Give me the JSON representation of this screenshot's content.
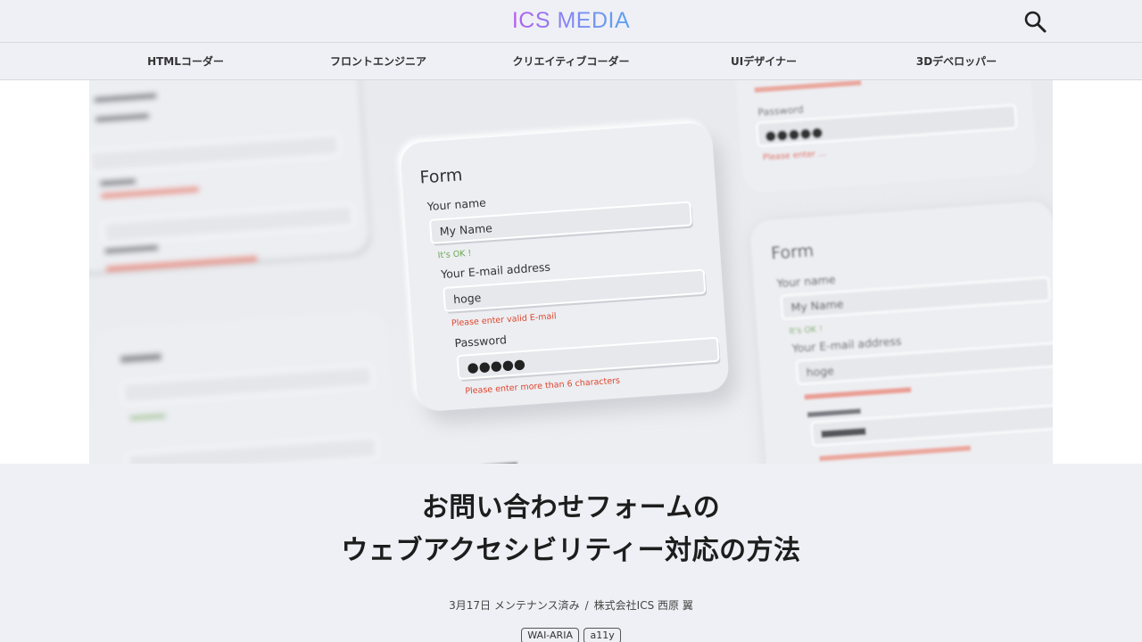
{
  "header": {
    "logo": "ICS MEDIA",
    "search_icon": "search-icon"
  },
  "categories": [
    "HTMLコーダー",
    "フロントエンジニア",
    "クリエイティブコーダー",
    "UIデザイナー",
    "3Dデベロッパー"
  ],
  "hero": {
    "main_card": {
      "title": "Form",
      "name_label": "Your name",
      "name_value": "My Name",
      "name_ok": "It's OK !",
      "email_label": "Your E-mail address",
      "email_value": "hoge",
      "email_error": "Please enter valid E-mail",
      "password_label": "Password",
      "password_value": "●●●●●",
      "password_error": "Please enter more than 6 characters"
    },
    "right_card": {
      "title": "Form",
      "name_label": "Your name",
      "name_value": "My Name",
      "name_ok": "It's OK !",
      "email_label": "Your E-mail address",
      "email_value": "hoge"
    },
    "top_right_card": {
      "password_label": "Password",
      "password_error": "Please enter ...",
      "ok_color": "#6aa84f",
      "error_color": "#e0452c"
    }
  },
  "article": {
    "title_line1": "お問い合わせフォームの",
    "title_line2": "ウェブアクセシビリティー対応の方法",
    "date": "3月17日 メンテナンス済み",
    "separator": "/",
    "author": "株式会社ICS 西原 翼",
    "tags": [
      "WAI-ARIA",
      "a11y"
    ]
  }
}
